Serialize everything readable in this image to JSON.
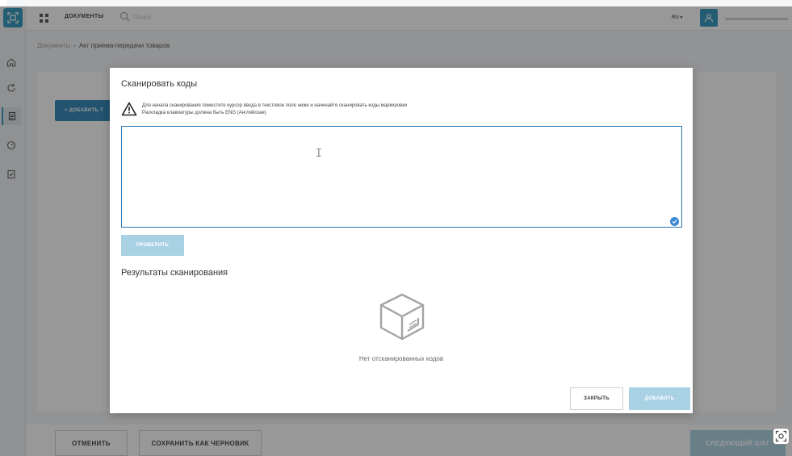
{
  "colors": {
    "accent": "#1e8fb8",
    "primary_button": "#1e7bb0",
    "disabled_button": "#a9d1e4",
    "input_border": "#2b78b5",
    "overlay": "rgba(40,40,40,0.48)"
  },
  "topbar": {
    "apps_icon": "grid-icon",
    "section_title": "ДОКУМЕНТЫ",
    "search_placeholder": "Поиск",
    "language": "RU ▾",
    "user_icon": "user-icon"
  },
  "sidebar": {
    "icons": [
      "scan-logo-icon",
      "home-icon",
      "refresh-icon",
      "document-icon",
      "gauge-icon",
      "checklist-icon"
    ]
  },
  "breadcrumb": {
    "root": "Документы",
    "separator": "›",
    "current": "Акт приема-передачи товаров"
  },
  "page": {
    "add_goods_label": "+ ДОБАВИТЬ Т",
    "cancel_label": "ОТМЕНИТЬ",
    "save_draft_label": "СОХРАНИТЬ КАК ЧЕРНОВИК",
    "next_step_label": "СЛЕДУЮЩИЙ ШАГ"
  },
  "modal": {
    "title": "Сканировать коды",
    "warning_line1": "Для начала сканирования поместите курсор ввода в текстовое поле ниже и начинайте сканировать коды маркировки",
    "warning_line2": "Раскладка клавиатуры должна быть ENG (Английская)",
    "scan_input_value": "",
    "verify_label": "ПРОВЕРИТЬ",
    "results_title": "Результаты сканирования",
    "empty_text": "Нет отсканированных кодов",
    "close_label": "ЗАКРЫТЬ",
    "add_label": "ДОБАВИТЬ"
  }
}
